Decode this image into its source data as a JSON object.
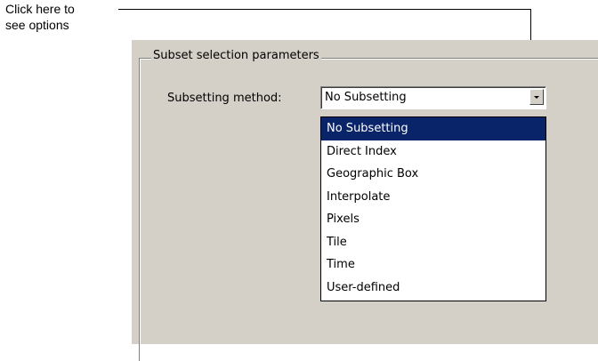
{
  "callout": {
    "line1": "Click here to",
    "line2": "see options"
  },
  "group": {
    "title": "Subset selection parameters"
  },
  "subsetting": {
    "label": "Subsetting method:",
    "selected": "No Subsetting",
    "dropdown_icon": "chevron-down-icon",
    "options": [
      "No Subsetting",
      "Direct Index",
      "Geographic Box",
      "Interpolate",
      "Pixels",
      "Tile",
      "Time",
      "User-defined"
    ],
    "highlighted_index": 0
  },
  "colors": {
    "panel": "#d4d0c8",
    "highlight": "#0a246a"
  }
}
